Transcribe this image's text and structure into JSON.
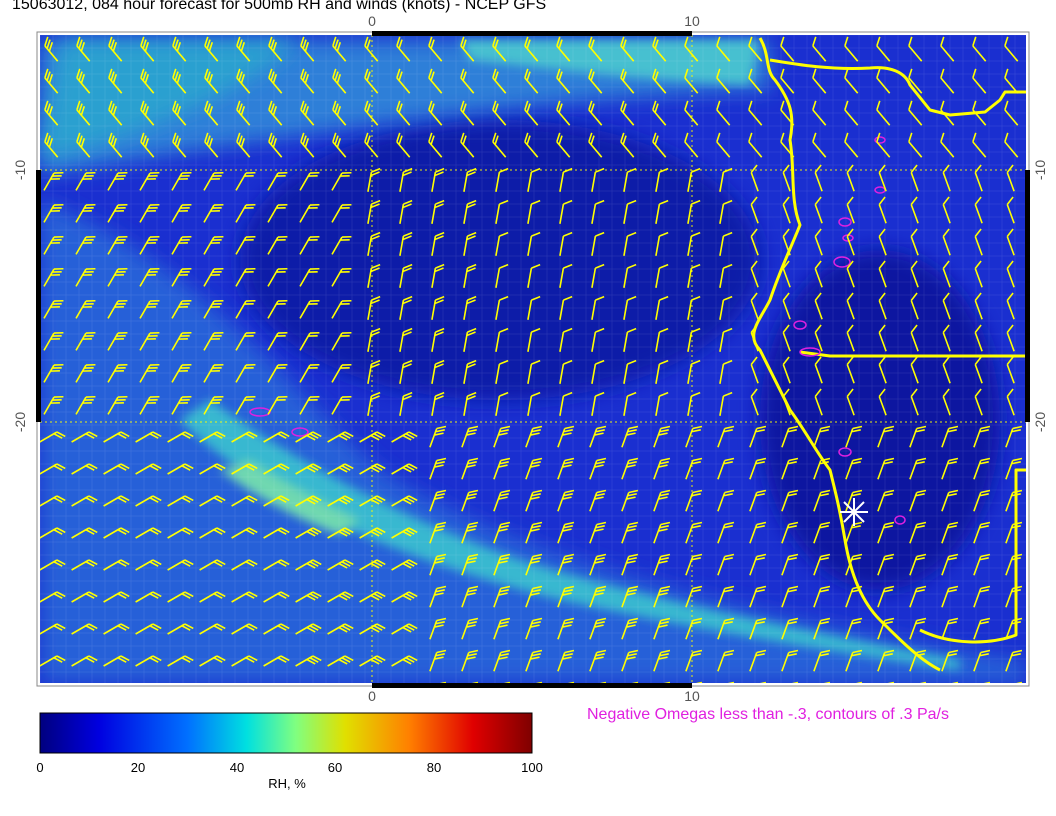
{
  "title": "15063012, 084 hour forecast for 500mb RH and winds (knots) - NCEP GFS",
  "omega_note": "Negative Omegas less than -.3, contours of .3 Pa/s",
  "colorbar": {
    "label": "RH, %",
    "ticks": [
      "0",
      "20",
      "40",
      "60",
      "80",
      "100"
    ],
    "stops": [
      "#00007f",
      "#0000e0",
      "#0070ff",
      "#00e0e0",
      "#80ff80",
      "#e0e000",
      "#ff8000",
      "#e00000",
      "#7f0000"
    ]
  },
  "axes": {
    "x_ticks": [
      "0",
      "10"
    ],
    "y_ticks": [
      "-10",
      "-20"
    ]
  },
  "colors": {
    "ocean_blue": "#1a2fd0",
    "moist_band": "#28a8d8",
    "barb": "#ffff00",
    "coast": "#ffff00",
    "omega_contour": "#e020e0",
    "station_marker": "#ffffff"
  }
}
